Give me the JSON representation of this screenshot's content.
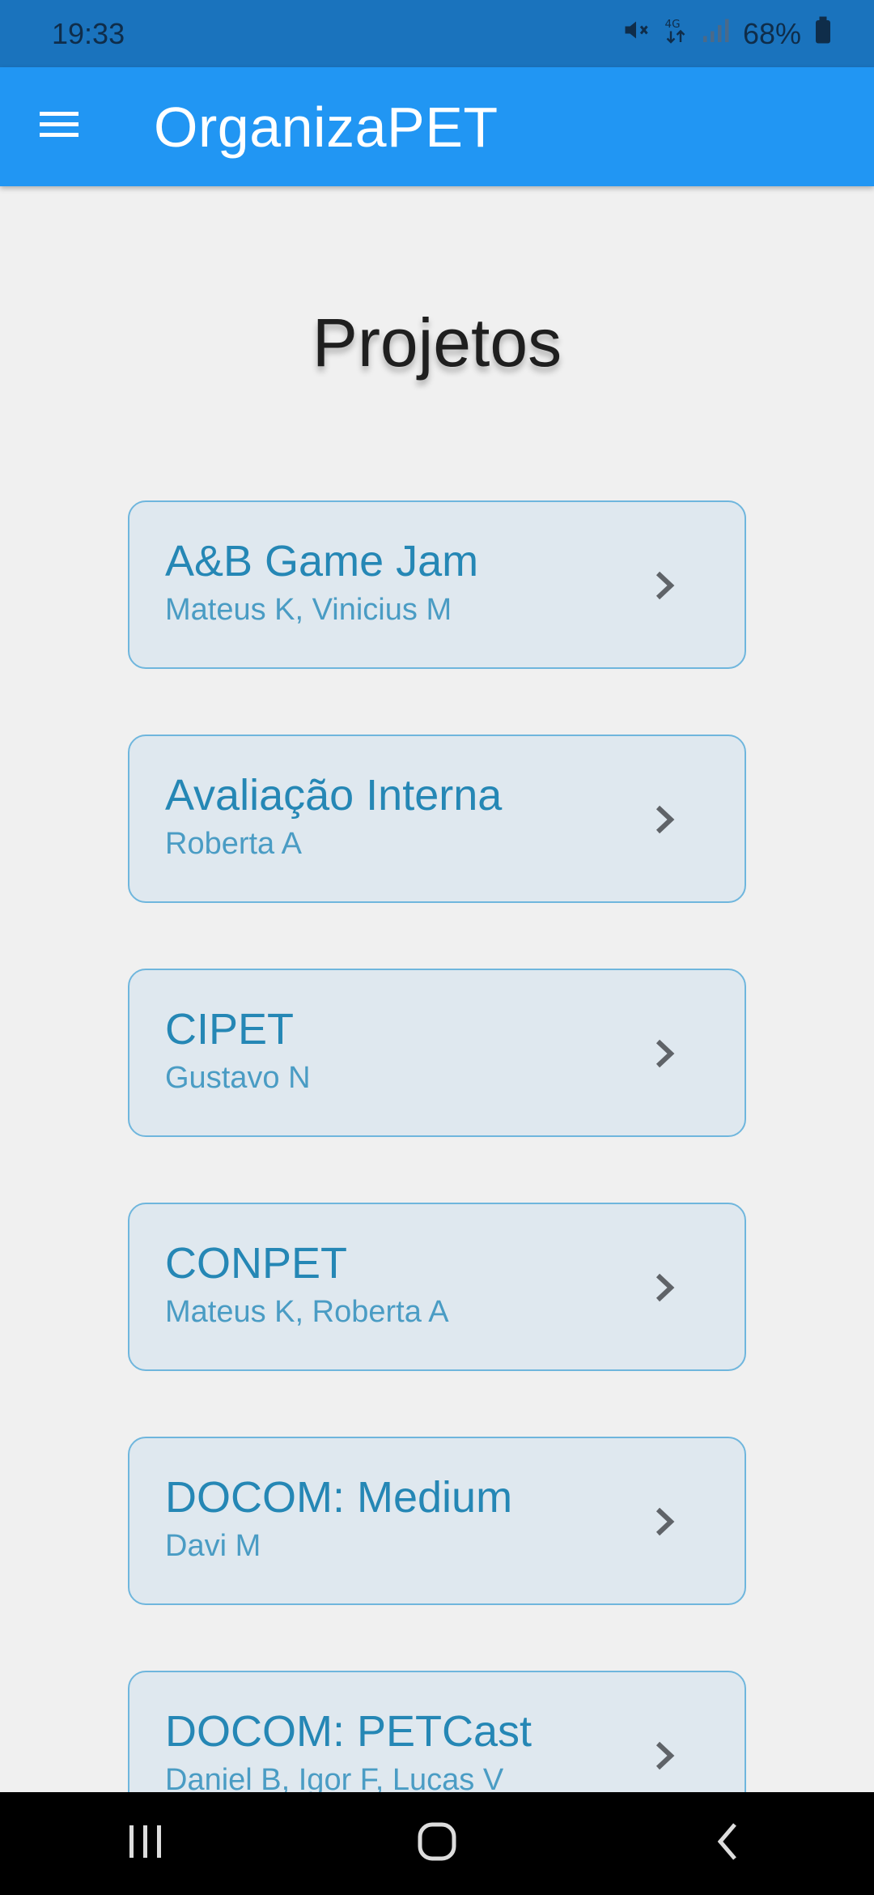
{
  "status_bar": {
    "time": "19:33",
    "battery": "68%",
    "icons": [
      "mute-icon",
      "4g-data-icon",
      "signal-icon",
      "battery-icon"
    ]
  },
  "app_bar": {
    "title": "OrganizaPET",
    "menu_icon": "hamburger-menu-icon"
  },
  "page": {
    "title": "Projetos"
  },
  "projects": [
    {
      "name": "A&B Game Jam",
      "members": "Mateus K, Vinicius M"
    },
    {
      "name": "Avaliação Interna",
      "members": "Roberta A"
    },
    {
      "name": "CIPET",
      "members": "Gustavo N"
    },
    {
      "name": "CONPET",
      "members": "Mateus K, Roberta A"
    },
    {
      "name": "DOCOM: Medium",
      "members": "Davi M"
    },
    {
      "name": "DOCOM: PETCast",
      "members": "Daniel B, Igor F, Lucas V"
    }
  ],
  "nav_bar": {
    "buttons": [
      "recents-icon",
      "home-icon",
      "back-icon"
    ]
  },
  "colors": {
    "status_bar": "#1a73bd",
    "app_bar": "#2196f3",
    "background": "#f0f0f0",
    "card_background": "#dfe8ef",
    "card_border": "#6fb6dd",
    "card_title": "#2587b5",
    "card_subtitle": "#4a9cc4"
  }
}
